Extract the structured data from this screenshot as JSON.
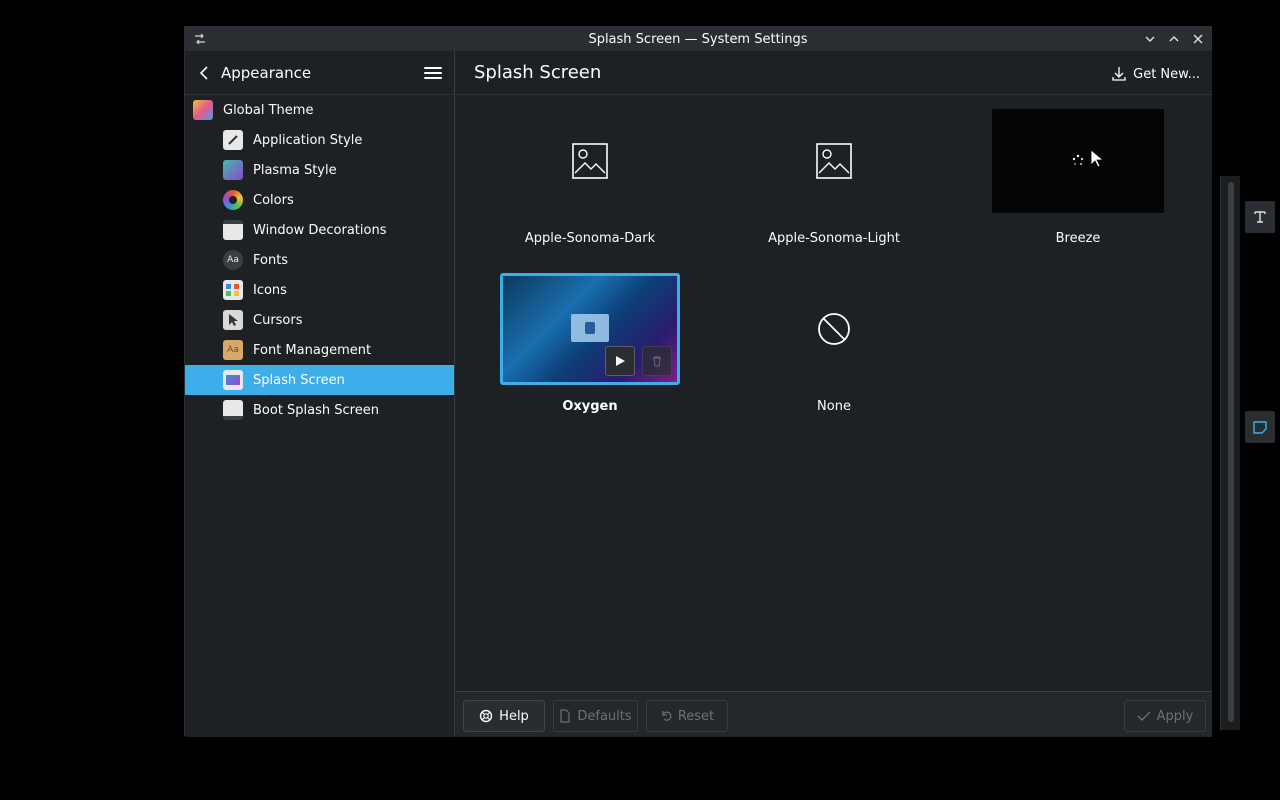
{
  "window": {
    "title": "Splash Screen — System Settings"
  },
  "sidebar": {
    "title": "Appearance",
    "items": [
      {
        "label": "Global Theme",
        "icon": "global-theme-icon",
        "color": "#e85a8a"
      },
      {
        "label": "Application Style",
        "icon": "application-style-icon",
        "color": "#e8e8e8"
      },
      {
        "label": "Plasma Style",
        "icon": "plasma-style-icon",
        "color": "#44b8b0"
      },
      {
        "label": "Colors",
        "icon": "colors-icon",
        "color": "#e05a2a"
      },
      {
        "label": "Window Decorations",
        "icon": "window-decorations-icon",
        "color": "#e8e8e8"
      },
      {
        "label": "Fonts",
        "icon": "fonts-icon",
        "color": "#3a3f44"
      },
      {
        "label": "Icons",
        "icon": "icons-icon",
        "color": "#e8e8e8"
      },
      {
        "label": "Cursors",
        "icon": "cursors-icon",
        "color": "#d8d8d8"
      },
      {
        "label": "Font Management",
        "icon": "font-management-icon",
        "color": "#d8a86a"
      },
      {
        "label": "Splash Screen",
        "icon": "splash-screen-icon",
        "color": "#6a4aa8",
        "active": true
      },
      {
        "label": "Boot Splash Screen",
        "icon": "boot-splash-screen-icon",
        "color": "#e8e8e8"
      }
    ]
  },
  "main": {
    "title": "Splash Screen",
    "get_new_label": "Get New...",
    "tiles": [
      {
        "label": "Apple-Sonoma-Dark",
        "icon": "image-placeholder-icon"
      },
      {
        "label": "Apple-Sonoma-Light",
        "icon": "image-placeholder-icon"
      },
      {
        "label": "Breeze",
        "icon": "loading-spinner-icon"
      },
      {
        "label": "Oxygen",
        "selected": true
      },
      {
        "label": "None",
        "icon": "none-icon"
      }
    ]
  },
  "footer": {
    "help_label": "Help",
    "defaults_label": "Defaults",
    "reset_label": "Reset",
    "apply_label": "Apply"
  },
  "colors": {
    "accent": "#3daee9",
    "window_bg": "#1e2124",
    "titlebar_bg": "#2a2e32"
  }
}
